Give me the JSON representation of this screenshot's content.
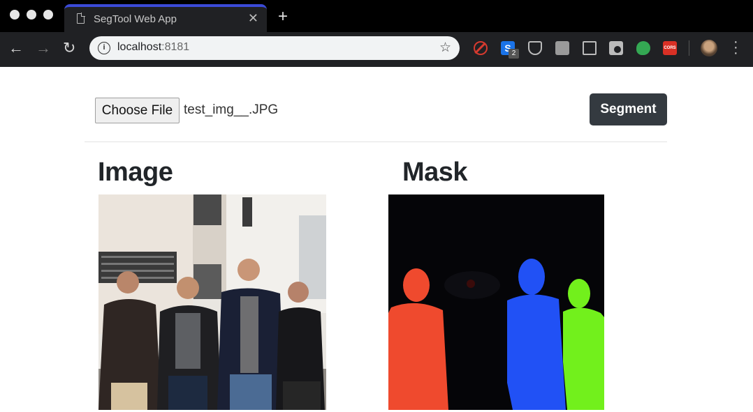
{
  "browser": {
    "tab_title": "SegTool Web App",
    "tab_close": "✕",
    "new_tab": "+",
    "url_host": "localhost",
    "url_port": ":8181",
    "extension_badge": "2",
    "ext_s_letter": "S",
    "ext_cors_label": "CORS",
    "accent_color": "#3b4bd8"
  },
  "upload": {
    "choose_file_label": "Choose File",
    "file_name": "test_img__.JPG"
  },
  "actions": {
    "segment_label": "Segment"
  },
  "image_panel": {
    "title": "Image"
  },
  "mask_panel": {
    "title": "Mask",
    "colors": [
      "#ef4a2e",
      "#2151f5",
      "#72f01c"
    ]
  }
}
